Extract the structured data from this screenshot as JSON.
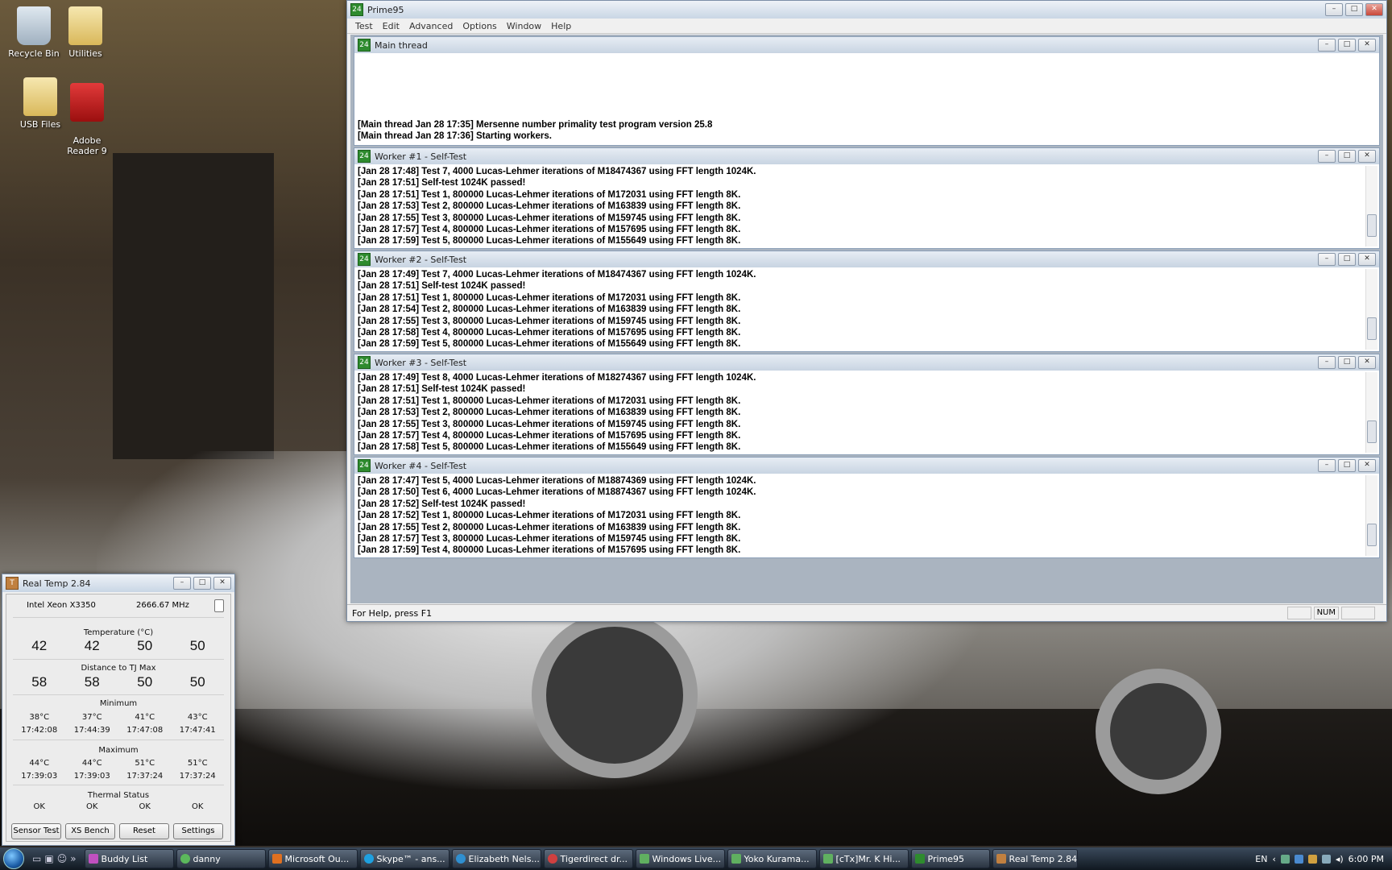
{
  "desktop_icons": [
    {
      "label": "Recycle Bin",
      "icon": "recycle-bin-icon"
    },
    {
      "label": "Utilities",
      "icon": "folder-icon"
    },
    {
      "label": "USB Files",
      "icon": "folder-icon"
    },
    {
      "label": "Adobe\nReader 9",
      "icon": "adobe-reader-icon"
    }
  ],
  "prime95": {
    "title": "Prime95",
    "menu": [
      "Test",
      "Edit",
      "Advanced",
      "Options",
      "Window",
      "Help"
    ],
    "status": "For Help, press F1",
    "status_num": "NUM",
    "windows": [
      {
        "title": "Main thread",
        "lines": [
          "[Main thread Jan 28 17:35] Mersenne number primality test program version 25.8",
          "[Main thread Jan 28 17:36] Starting workers."
        ]
      },
      {
        "title": "Worker #1 - Self-Test",
        "lines": [
          "[Jan 28 17:48] Test 7, 4000 Lucas-Lehmer iterations of M18474367 using FFT length 1024K.",
          "[Jan 28 17:51] Self-test 1024K passed!",
          "[Jan 28 17:51] Test 1, 800000 Lucas-Lehmer iterations of M172031 using FFT length 8K.",
          "[Jan 28 17:53] Test 2, 800000 Lucas-Lehmer iterations of M163839 using FFT length 8K.",
          "[Jan 28 17:55] Test 3, 800000 Lucas-Lehmer iterations of M159745 using FFT length 8K.",
          "[Jan 28 17:57] Test 4, 800000 Lucas-Lehmer iterations of M157695 using FFT length 8K.",
          "[Jan 28 17:59] Test 5, 800000 Lucas-Lehmer iterations of M155649 using FFT length 8K."
        ]
      },
      {
        "title": "Worker #2 - Self-Test",
        "lines": [
          "[Jan 28 17:49] Test 7, 4000 Lucas-Lehmer iterations of M18474367 using FFT length 1024K.",
          "[Jan 28 17:51] Self-test 1024K passed!",
          "[Jan 28 17:51] Test 1, 800000 Lucas-Lehmer iterations of M172031 using FFT length 8K.",
          "[Jan 28 17:54] Test 2, 800000 Lucas-Lehmer iterations of M163839 using FFT length 8K.",
          "[Jan 28 17:55] Test 3, 800000 Lucas-Lehmer iterations of M159745 using FFT length 8K.",
          "[Jan 28 17:58] Test 4, 800000 Lucas-Lehmer iterations of M157695 using FFT length 8K.",
          "[Jan 28 17:59] Test 5, 800000 Lucas-Lehmer iterations of M155649 using FFT length 8K."
        ]
      },
      {
        "title": "Worker #3 - Self-Test",
        "lines": [
          "[Jan 28 17:49] Test 8, 4000 Lucas-Lehmer iterations of M18274367 using FFT length 1024K.",
          "[Jan 28 17:51] Self-test 1024K passed!",
          "[Jan 28 17:51] Test 1, 800000 Lucas-Lehmer iterations of M172031 using FFT length 8K.",
          "[Jan 28 17:53] Test 2, 800000 Lucas-Lehmer iterations of M163839 using FFT length 8K.",
          "[Jan 28 17:55] Test 3, 800000 Lucas-Lehmer iterations of M159745 using FFT length 8K.",
          "[Jan 28 17:57] Test 4, 800000 Lucas-Lehmer iterations of M157695 using FFT length 8K.",
          "[Jan 28 17:58] Test 5, 800000 Lucas-Lehmer iterations of M155649 using FFT length 8K."
        ]
      },
      {
        "title": "Worker #4 - Self-Test",
        "lines": [
          "[Jan 28 17:47] Test 5, 4000 Lucas-Lehmer iterations of M18874369 using FFT length 1024K.",
          "[Jan 28 17:50] Test 6, 4000 Lucas-Lehmer iterations of M18874367 using FFT length 1024K.",
          "[Jan 28 17:52] Self-test 1024K passed!",
          "[Jan 28 17:52] Test 1, 800000 Lucas-Lehmer iterations of M172031 using FFT length 8K.",
          "[Jan 28 17:55] Test 2, 800000 Lucas-Lehmer iterations of M163839 using FFT length 8K.",
          "[Jan 28 17:57] Test 3, 800000 Lucas-Lehmer iterations of M159745 using FFT length 8K.",
          "[Jan 28 17:59] Test 4, 800000 Lucas-Lehmer iterations of M157695 using FFT length 8K."
        ]
      }
    ]
  },
  "realtemp": {
    "title": "Real Temp 2.84",
    "cpu": "Intel Xeon X3350",
    "mhz": "2666.67 MHz",
    "temp_label": "Temperature (°C)",
    "temps": [
      "42",
      "42",
      "50",
      "50"
    ],
    "dist_label": "Distance to TJ Max",
    "dist": [
      "58",
      "58",
      "50",
      "50"
    ],
    "min_label": "Minimum",
    "min_temps": [
      "38°C",
      "37°C",
      "41°C",
      "43°C"
    ],
    "min_times": [
      "17:42:08",
      "17:44:39",
      "17:47:08",
      "17:47:41"
    ],
    "max_label": "Maximum",
    "max_temps": [
      "44°C",
      "44°C",
      "51°C",
      "51°C"
    ],
    "max_times": [
      "17:39:03",
      "17:39:03",
      "17:37:24",
      "17:37:24"
    ],
    "thermal_label": "Thermal Status",
    "thermal": [
      "OK",
      "OK",
      "OK",
      "OK"
    ],
    "buttons": [
      "Sensor Test",
      "XS Bench",
      "Reset",
      "Settings"
    ]
  },
  "taskbar": {
    "items": [
      {
        "label": "Buddy List",
        "color": "#c050c0"
      },
      {
        "label": "danny",
        "color": "#5cb85c"
      },
      {
        "label": "Microsoft Ou...",
        "color": "#e07020"
      },
      {
        "label": "Skype™ - ans...",
        "color": "#1ea0e0"
      },
      {
        "label": "Elizabeth Nels...",
        "color": "#2f8fd0"
      },
      {
        "label": "Tigerdirect dr...",
        "color": "#d04040"
      },
      {
        "label": "Windows Live...",
        "color": "#60b060"
      },
      {
        "label": "Yoko Kurama...",
        "color": "#60b060"
      },
      {
        "label": "[cTx]Mr. K Hi...",
        "color": "#60b060"
      },
      {
        "label": "Prime95",
        "color": "#2e8b2e"
      },
      {
        "label": "Real Temp 2.84",
        "color": "#c08040"
      }
    ],
    "lang": "EN",
    "clock": "6:00 PM"
  }
}
